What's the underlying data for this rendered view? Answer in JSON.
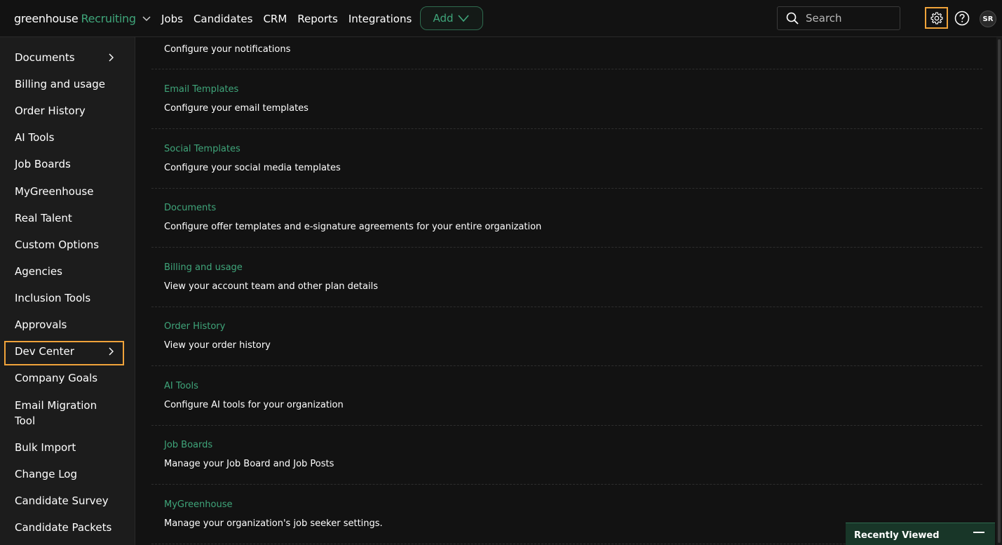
{
  "brand": {
    "name": "greenhouse",
    "product": "Recruiting"
  },
  "nav": {
    "items": [
      "Jobs",
      "Candidates",
      "CRM",
      "Reports",
      "Integrations"
    ],
    "add_label": "Add"
  },
  "search": {
    "placeholder": "Search"
  },
  "user": {
    "initials": "SR"
  },
  "sidebar": {
    "items": [
      {
        "label": "Documents",
        "chevron": true
      },
      {
        "label": "Billing and usage"
      },
      {
        "label": "Order History"
      },
      {
        "label": "AI Tools"
      },
      {
        "label": "Job Boards"
      },
      {
        "label": "MyGreenhouse"
      },
      {
        "label": "Real Talent"
      },
      {
        "label": "Custom Options"
      },
      {
        "label": "Agencies"
      },
      {
        "label": "Inclusion Tools"
      },
      {
        "label": "Approvals"
      },
      {
        "label": "Dev Center",
        "chevron": true,
        "highlighted": true
      },
      {
        "label": "Company Goals"
      },
      {
        "label": "Email Migration Tool"
      },
      {
        "label": "Bulk Import"
      },
      {
        "label": "Change Log"
      },
      {
        "label": "Candidate Survey"
      },
      {
        "label": "Candidate Packets"
      }
    ]
  },
  "main": {
    "first_desc": "Configure your notifications",
    "rows": [
      {
        "title": "Email Templates",
        "desc": "Configure your email templates"
      },
      {
        "title": "Social Templates",
        "desc": "Configure your social media templates"
      },
      {
        "title": "Documents",
        "desc": "Configure offer templates and e-signature agreements for your entire organization"
      },
      {
        "title": "Billing and usage",
        "desc": "View your account team and other plan details"
      },
      {
        "title": "Order History",
        "desc": "View your order history"
      },
      {
        "title": "AI Tools",
        "desc": "Configure AI tools for your organization"
      },
      {
        "title": "Job Boards",
        "desc": "Manage your Job Board and Job Posts"
      },
      {
        "title": "MyGreenhouse",
        "desc": "Manage your organization's job seeker settings."
      }
    ]
  },
  "recently_viewed": {
    "label": "Recently Viewed"
  },
  "colors": {
    "accent_green": "#3fa57a",
    "highlight_orange": "#f0a33a",
    "background": "#121212",
    "sidebar_bg": "#1c1c1c"
  }
}
